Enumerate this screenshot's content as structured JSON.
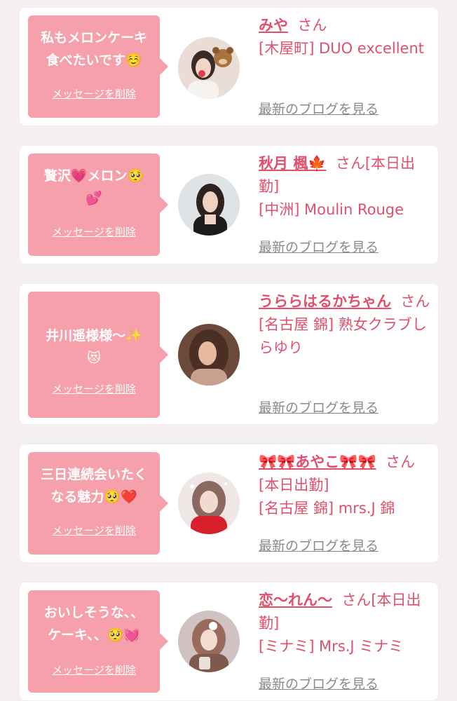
{
  "delete_label": "メッセージを削除",
  "blog_label": "最新のブログを見る",
  "colors": {
    "bubble": "#f6a0ac",
    "accent": "#e0506c",
    "link_gray": "#8a8a8a",
    "background": "#f4eff0"
  },
  "cards": [
    {
      "message": "私もメロンケーキ\n食べたいです☺️",
      "name": "みや",
      "suffix": "さん",
      "shop": "[木屋町] DUO excellent",
      "avatar_icon": "woman-portrait-with-bear-sticker"
    },
    {
      "message": "贅沢💗メロン🥺\n💕",
      "name": "秋月 楓🍁",
      "suffix": "さん[本日出勤]",
      "shop": "[中洲] Moulin Rouge",
      "avatar_icon": "woman-portrait"
    },
    {
      "message": "井川遥様様〜✨\n😻",
      "name": "うららはるかちゃん",
      "suffix": "さん",
      "shop": "[名古屋 錦] 熟女クラブしらゆり",
      "avatar_icon": "woman-portrait"
    },
    {
      "message": "三日連続会いたく\nなる魅力🥺❤️",
      "name": "🎀🎀あやこ🎀🎀",
      "suffix": "さん[本日出勤]",
      "shop": "[名古屋 錦] mrs.J 錦",
      "avatar_icon": "woman-portrait"
    },
    {
      "message": "おいしそうな、、\nケーキ、、🥺💓",
      "name": "恋〜れん〜",
      "suffix": "さん[本日出勤]",
      "shop": "[ミナミ] Mrs.J ミナミ",
      "avatar_icon": "woman-portrait"
    }
  ]
}
